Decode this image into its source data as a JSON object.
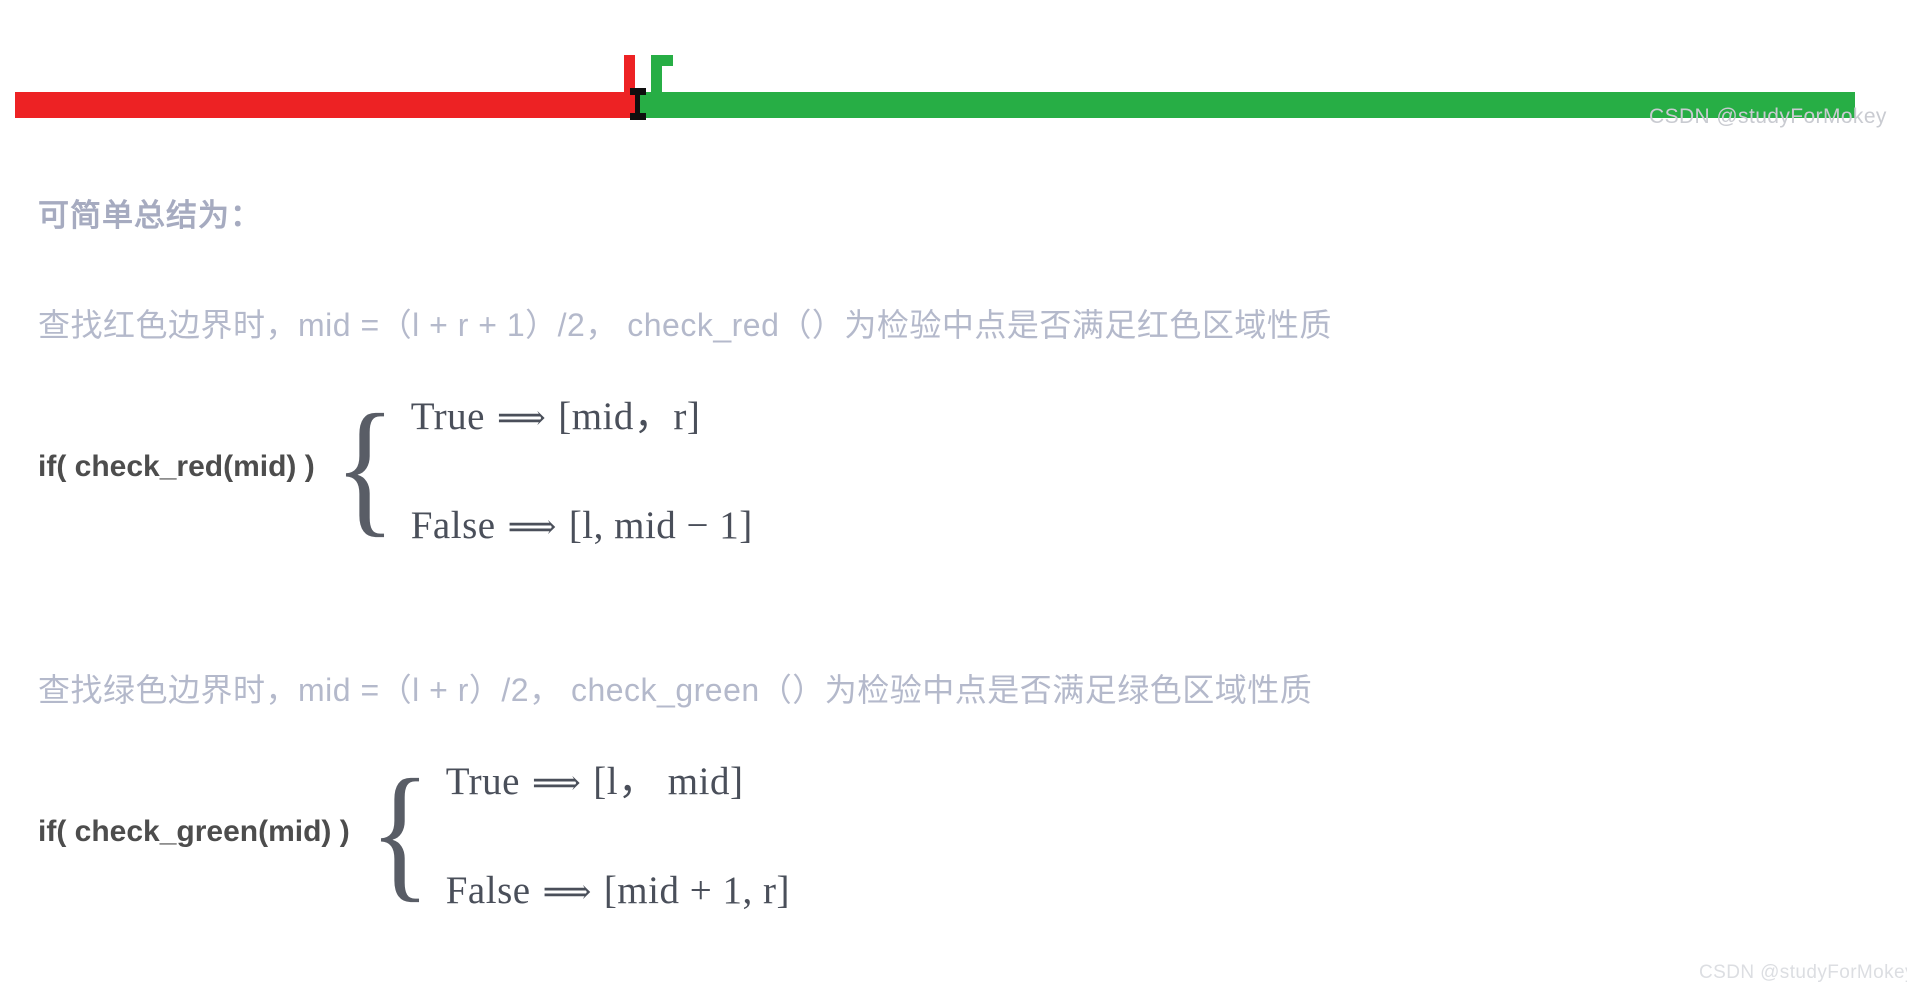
{
  "diagram": {
    "red_region_label": "red-region-bar",
    "green_region_label": "green-region-bar",
    "colors": {
      "red": "#ed2224",
      "green": "#27ae45",
      "marker": "#0e0e0e"
    }
  },
  "watermark": {
    "top": "CSDN @studyForMokey",
    "bottom": "CSDN @studyForMokey"
  },
  "content": {
    "heading": "可简单总结为：",
    "desc_red": "查找红色边界时，mid =（l + r + 1）/2， check_red（）为检验中点是否满足红色区域性质",
    "desc_green": "查找绿色边界时，mid =（l + r）/2， check_green（）为检验中点是否满足绿色区域性质"
  },
  "formula_red": {
    "label": "if( check_red(mid) )",
    "brace": "{",
    "branches": [
      {
        "cond": "True",
        "arrow": "⟹",
        "result": "[mid，r]"
      },
      {
        "cond": "False",
        "arrow": "⟹",
        "result": "[l, mid − 1]"
      }
    ]
  },
  "formula_green": {
    "label": "if( check_green(mid) )",
    "brace": "{",
    "branches": [
      {
        "cond": "True",
        "arrow": "⟹",
        "result": "[l， mid]"
      },
      {
        "cond": "False",
        "arrow": "⟹",
        "result": "[mid + 1, r]"
      }
    ]
  }
}
